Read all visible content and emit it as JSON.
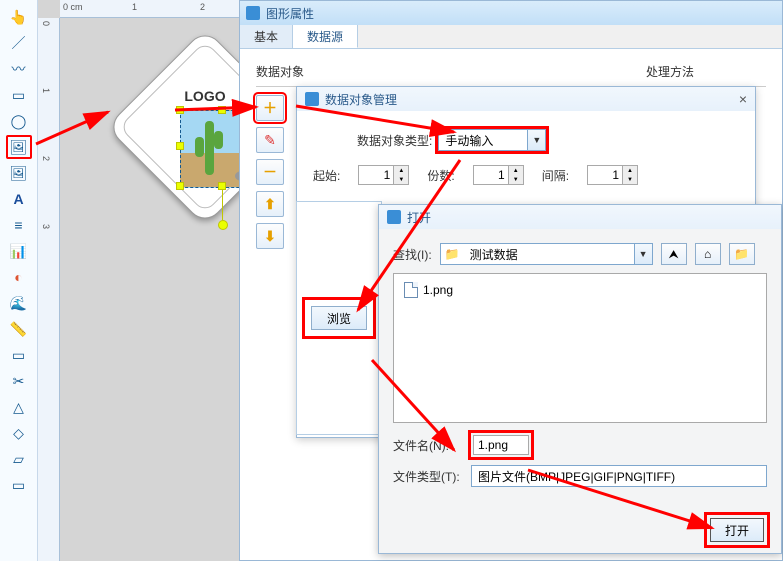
{
  "toolbar": {
    "icons": [
      "👆",
      "／",
      "〰",
      "▭",
      "◯",
      "🖼",
      "🖼",
      "A",
      "≡",
      "📊",
      "◐",
      "🌊",
      "📏",
      "▭",
      "✂",
      "△",
      "◇",
      "▱",
      "▭"
    ]
  },
  "ruler": {
    "h": [
      "0 cm",
      "1",
      "2"
    ],
    "v": [
      "0",
      "1",
      "2",
      "3"
    ]
  },
  "logo_text": "LOGO",
  "panel1": {
    "title": "图形属性",
    "tabs": {
      "basic": "基本",
      "data_source": "数据源"
    },
    "sections": {
      "data_object": "数据对象",
      "process_method": "处理方法"
    }
  },
  "dlg2": {
    "title": "数据对象管理",
    "type_label": "数据对象类型:",
    "type_value": "手动输入",
    "start_label": "起始:",
    "start_value": "1",
    "count_label": "份数:",
    "count_value": "1",
    "gap_label": "间隔:",
    "gap_value": "1"
  },
  "browse_label": "浏览",
  "dlg3": {
    "title": "打开",
    "lookin_label": "查找(I):",
    "lookin_value": "测试数据",
    "file1": "1.png",
    "filename_label": "文件名(N):",
    "filename_value": "1.png",
    "filetype_label": "文件类型(T):",
    "filetype_value": "图片文件(BMP|JPEG|GIF|PNG|TIFF)",
    "open_btn": "打开"
  }
}
